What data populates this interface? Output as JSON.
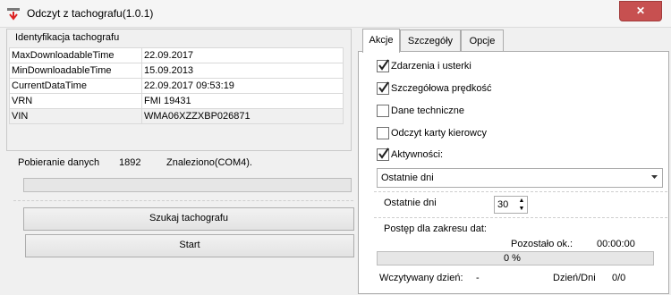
{
  "window": {
    "title": "Odczyt z tachografu(1.0.1)",
    "close_label": "✕"
  },
  "identification": {
    "group_title": "Identyfikacja tachografu",
    "rows": [
      {
        "key": "MaxDownloadableTime",
        "value": "22.09.2017"
      },
      {
        "key": "MinDownloadableTime",
        "value": "15.09.2013"
      },
      {
        "key": "CurrentDataTime",
        "value": "22.09.2017 09:53:19"
      },
      {
        "key": "VRN",
        "value": "FMI 19431"
      },
      {
        "key": "VIN",
        "value": "WMA06XZZXBP026871"
      }
    ]
  },
  "download": {
    "label": "Pobieranie danych",
    "count": "1892",
    "status": "Znaleziono(COM4)."
  },
  "buttons": {
    "search": "Szukaj tachografu",
    "start": "Start"
  },
  "tabs": [
    {
      "label": "Akcje"
    },
    {
      "label": "Szczegóły"
    },
    {
      "label": "Opcje"
    }
  ],
  "actions": {
    "checkboxes": [
      {
        "label": "Zdarzenia i usterki",
        "checked": true
      },
      {
        "label": "Szczegółowa prędkość",
        "checked": true
      },
      {
        "label": "Dane techniczne",
        "checked": false
      },
      {
        "label": "Odczyt karty kierowcy",
        "checked": false
      },
      {
        "label": "Aktywności:",
        "checked": true
      }
    ],
    "period_select": "Ostatnie dni",
    "last_days_label": "Ostatnie dni",
    "last_days_value": "30",
    "progress_title": "Postęp dla zakresu dat:",
    "remaining_label": "Pozostało ok.:",
    "remaining_value": "00:00:00",
    "percent": "0 %",
    "progress_fraction": 0,
    "read_day_label": "Wczytywany dzień:",
    "read_day_value": "-",
    "day_count_label": "Dzień/Dni",
    "day_count_value": "0/0"
  }
}
